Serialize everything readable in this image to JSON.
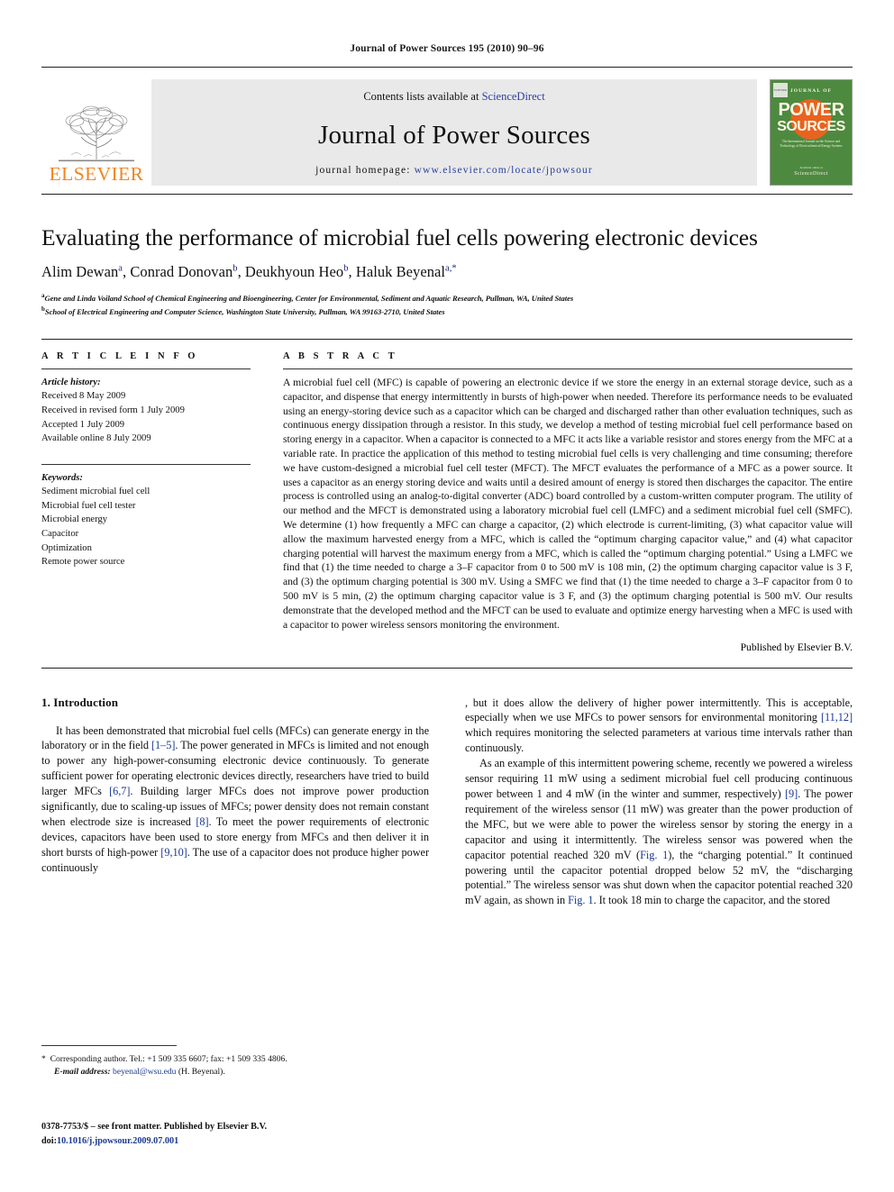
{
  "running_head": "Journal of Power Sources 195 (2010) 90–96",
  "masthead": {
    "publisher_name": "ELSEVIER",
    "contents_prefix": "Contents lists available at ",
    "contents_link": "ScienceDirect",
    "journal_title": "Journal of Power Sources",
    "homepage_prefix": "journal homepage: ",
    "homepage_url": "www.elsevier.com/locate/jpowsour",
    "cover": {
      "brand_top": "JOURNAL OF",
      "line1": "POWER",
      "line2": "SOURCES",
      "subtitle": "The International Journal on the Science and Technology of Electrochemical Energy Systems",
      "footer_small": "Available online at",
      "footer_big": "ScienceDirect",
      "elsevier_badge": "ELSEVIER"
    }
  },
  "title": "Evaluating the performance of microbial fuel cells powering electronic devices",
  "authors": [
    {
      "name": "Alim Dewan",
      "sup": "a"
    },
    {
      "name": "Conrad Donovan",
      "sup": "b"
    },
    {
      "name": "Deukhyoun Heo",
      "sup": "b"
    },
    {
      "name": "Haluk Beyenal",
      "sup": "a,",
      "star": "*"
    }
  ],
  "affiliations": [
    {
      "marker": "a",
      "text": "Gene and Linda Voiland School of Chemical Engineering and Bioengineering, Center for Environmental, Sediment and Aquatic Research, Pullman, WA, United States"
    },
    {
      "marker": "b",
      "text": "School of Electrical Engineering and Computer Science, Washington State University, Pullman, WA 99163-2710, United States"
    }
  ],
  "article_info": {
    "heading": "A R T I C L E    I N F O",
    "history_label": "Article history:",
    "history": [
      "Received 8 May 2009",
      "Received in revised form 1 July 2009",
      "Accepted 1 July 2009",
      "Available online 8 July 2009"
    ],
    "keywords_label": "Keywords:",
    "keywords": [
      "Sediment microbial fuel cell",
      "Microbial fuel cell tester",
      "Microbial energy",
      "Capacitor",
      "Optimization",
      "Remote power source"
    ]
  },
  "abstract": {
    "heading": "A B S T R A C T",
    "text": "A microbial fuel cell (MFC) is capable of powering an electronic device if we store the energy in an external storage device, such as a capacitor, and dispense that energy intermittently in bursts of high-power when needed. Therefore its performance needs to be evaluated using an energy-storing device such as a capacitor which can be charged and discharged rather than other evaluation techniques, such as continuous energy dissipation through a resistor. In this study, we develop a method of testing microbial fuel cell performance based on storing energy in a capacitor. When a capacitor is connected to a MFC it acts like a variable resistor and stores energy from the MFC at a variable rate. In practice the application of this method to testing microbial fuel cells is very challenging and time consuming; therefore we have custom-designed a microbial fuel cell tester (MFCT). The MFCT evaluates the performance of a MFC as a power source. It uses a capacitor as an energy storing device and waits until a desired amount of energy is stored then discharges the capacitor. The entire process is controlled using an analog-to-digital converter (ADC) board controlled by a custom-written computer program. The utility of our method and the MFCT is demonstrated using a laboratory microbial fuel cell (LMFC) and a sediment microbial fuel cell (SMFC). We determine (1) how frequently a MFC can charge a capacitor, (2) which electrode is current-limiting, (3) what capacitor value will allow the maximum harvested energy from a MFC, which is called the “optimum charging capacitor value,” and (4) what capacitor charging potential will harvest the maximum energy from a MFC, which is called the “optimum charging potential.” Using a LMFC we find that (1) the time needed to charge a 3–F capacitor from 0 to 500 mV is 108 min, (2) the optimum charging capacitor value is 3 F, and (3) the optimum charging potential is 300 mV. Using a SMFC we find that (1) the time needed to charge a 3–F capacitor from 0 to 500 mV is 5 min, (2) the optimum charging capacitor value is 3 F, and (3) the optimum charging potential is 500 mV. Our results demonstrate that the developed method and the MFCT can be used to evaluate and optimize energy harvesting when a MFC is used with a capacitor to power wireless sensors monitoring the environment.",
    "publisher_line": "Published by Elsevier B.V."
  },
  "introduction": {
    "heading": "1.  Introduction",
    "paragraph_1_part1": "It has been demonstrated that microbial fuel cells (MFCs) can generate energy in the laboratory or in the field ",
    "ref_1_5": "[1–5]",
    "paragraph_1_part2": ". The power generated in MFCs is limited and not enough to power any high-power-consuming electronic device continuously. To generate sufficient power for operating electronic devices directly, researchers have tried to build larger MFCs ",
    "ref_6_7": "[6,7]",
    "paragraph_1_part3": ". Building larger MFCs does not improve power production significantly, due to scaling-up issues of MFCs; power density does not remain constant when electrode size is increased ",
    "ref_8": "[8]",
    "paragraph_1_part4": ". To meet the power requirements of electronic devices, capacitors have been used to store energy from MFCs and then deliver it in short bursts of high-power ",
    "ref_9_10": "[9,10]",
    "paragraph_1_part5": ". The use of a capacitor does not produce higher power continuously, but it does allow the delivery of higher power intermittently. This is acceptable, especially when we use MFCs to power sensors for environmental monitoring ",
    "ref_11_12": "[11,12]",
    "paragraph_1_part6": " which requires monitoring the selected parameters at various time intervals rather than continuously.",
    "paragraph_2_part1": "As an example of this intermittent powering scheme, recently we powered a wireless sensor requiring 11 mW using a sediment microbial fuel cell producing continuous power between 1 and 4 mW (in the winter and summer, respectively) ",
    "ref_9": "[9]",
    "paragraph_2_part2": ". The power requirement of the wireless sensor (11 mW) was greater than the power production of the MFC, but we were able to power the wireless sensor by storing the energy in a capacitor and using it intermittently. The wireless sensor was powered when the capacitor potential reached 320 mV (",
    "fig_ref_1": "Fig. 1",
    "paragraph_2_part3": "), the “charging potential.” It continued powering until the capacitor potential dropped below 52 mV, the “discharging potential.” The wireless sensor was shut down when the capacitor potential reached 320 mV again, as shown in ",
    "fig_ref_2": "Fig. 1",
    "paragraph_2_part4": ". It took 18 min to charge the capacitor, and the stored"
  },
  "footnotes": {
    "corresponding_marker": "*",
    "corresponding_text": "Corresponding author. Tel.: +1 509 335 6607; fax: +1 509 335 4806.",
    "email_label": "E-mail address:",
    "email": "beyenal@wsu.edu",
    "email_owner": "(H. Beyenal)."
  },
  "imprint": {
    "issn_line": "0378-7753/$ – see front matter. Published by Elsevier B.V.",
    "doi_label": "doi:",
    "doi": "10.1016/j.jpowsour.2009.07.001"
  },
  "colors": {
    "elsevier_orange": "#ee8622",
    "link_blue": "#2b3f9e",
    "ref_blue": "#1a3a8f",
    "masthead_gray": "#e9e9e9",
    "cover_green": "#4d8a3f",
    "cover_orange": "#e8631f"
  }
}
